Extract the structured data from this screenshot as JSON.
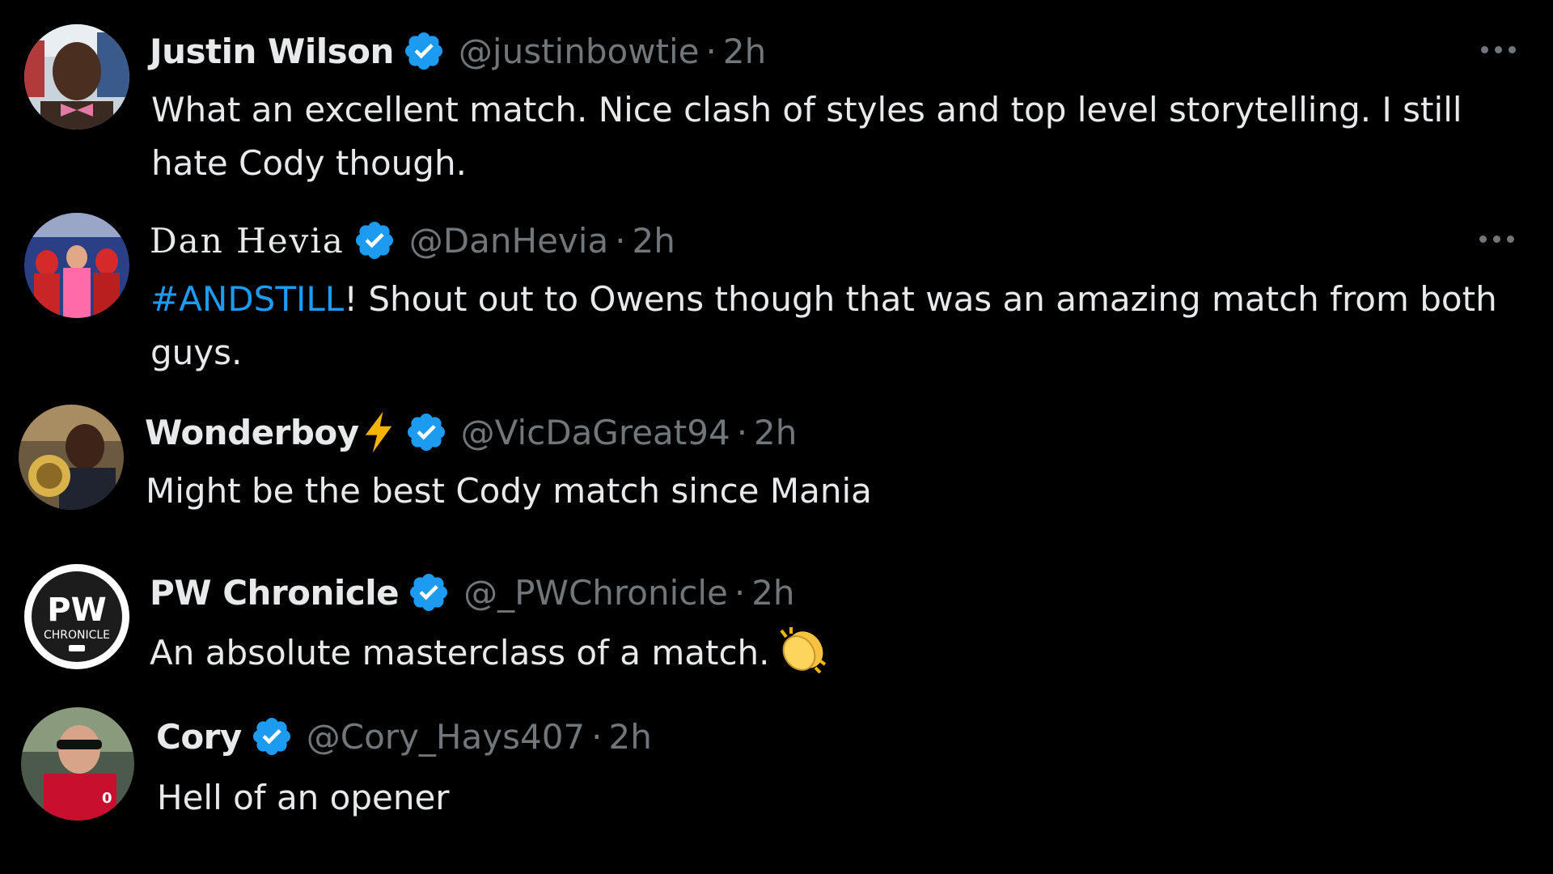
{
  "colors": {
    "background": "#000000",
    "text": "#e7e9ea",
    "muted": "#71767b",
    "accent": "#1d9bf0"
  },
  "tweets": [
    {
      "name": "Justin Wilson",
      "handle": "@justinbowtie",
      "separator": "·",
      "time": "2h",
      "verified": true,
      "text": "What an excellent match. Nice clash of styles and top level storytelling. I still hate Cody though.",
      "icons": [
        "verified-badge-icon",
        "more-options-icon"
      ]
    },
    {
      "name": "Dan Hevia",
      "handle": "@DanHevia",
      "separator": "·",
      "time": "2h",
      "verified": true,
      "hashtag": "#ANDSTILL",
      "text": "! Shout out to Owens though that was an amazing match from both guys.",
      "icons": [
        "verified-badge-icon",
        "more-options-icon"
      ]
    },
    {
      "name": "Wonderboy",
      "handle": "@VicDaGreat94",
      "separator": "·",
      "time": "2h",
      "verified": true,
      "text": "Might be the best Cody match since Mania",
      "icons": [
        "lightning-emoji-icon",
        "verified-badge-icon"
      ]
    },
    {
      "name": "PW Chronicle",
      "handle": "@_PWChronicle",
      "separator": "·",
      "time": "2h",
      "verified": true,
      "text": "An absolute masterclass of a match.",
      "avatar_text": [
        "PW",
        "CHRONICLE"
      ],
      "icons": [
        "verified-badge-icon",
        "clapping-hands-emoji-icon"
      ]
    },
    {
      "name": "Cory",
      "handle": "@Cory_Hays407",
      "separator": "·",
      "time": "2h",
      "verified": true,
      "text": "Hell of an opener",
      "icons": [
        "verified-badge-icon"
      ]
    }
  ]
}
